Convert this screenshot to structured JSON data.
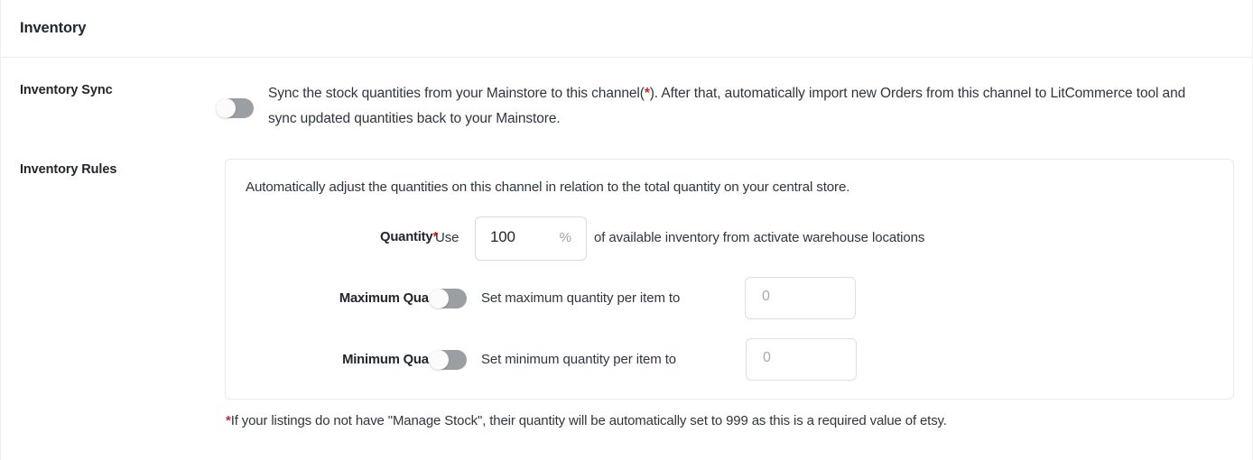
{
  "card": {
    "title": "Inventory"
  },
  "inventory_sync": {
    "label": "Inventory Sync",
    "toggle_state": "off",
    "description_part1": "Sync the stock quantities from your Mainstore to this channel(",
    "description_star": "*",
    "description_part2": "). After that, automatically import new Orders from this channel to LitCommerce tool and sync updated quantities back to your Mainstore."
  },
  "inventory_rules": {
    "label": "Inventory Rules",
    "intro": "Automatically adjust the quantities on this channel in relation to the total quantity on your central store.",
    "quantity": {
      "label": "Quantity",
      "required_marker": "*",
      "prefix_text": "Use",
      "value": "100",
      "suffix": "%",
      "trailing_text": "of available inventory from activate warehouse locations"
    },
    "maximum_quantity": {
      "label": "Maximum Quantity",
      "toggle_state": "off",
      "text": "Set maximum quantity per item to",
      "placeholder": "0",
      "value": ""
    },
    "minimum_quantity": {
      "label": "Minimum Quantity",
      "toggle_state": "off",
      "text": "Set minimum quantity per item to",
      "placeholder": "0",
      "value": ""
    }
  },
  "footnote": {
    "star": "*",
    "text": "If your listings do not have \"Manage Stock\", their quantity will be automatically set to 999 as this is a required value of etsy."
  },
  "colors": {
    "required_red": "#e02020",
    "toggle_off_track": "#9b9ea2",
    "text_primary": "#20272e",
    "text_body": "#2f3640",
    "placeholder": "#a5aab0",
    "border": "#e7e9eb"
  }
}
